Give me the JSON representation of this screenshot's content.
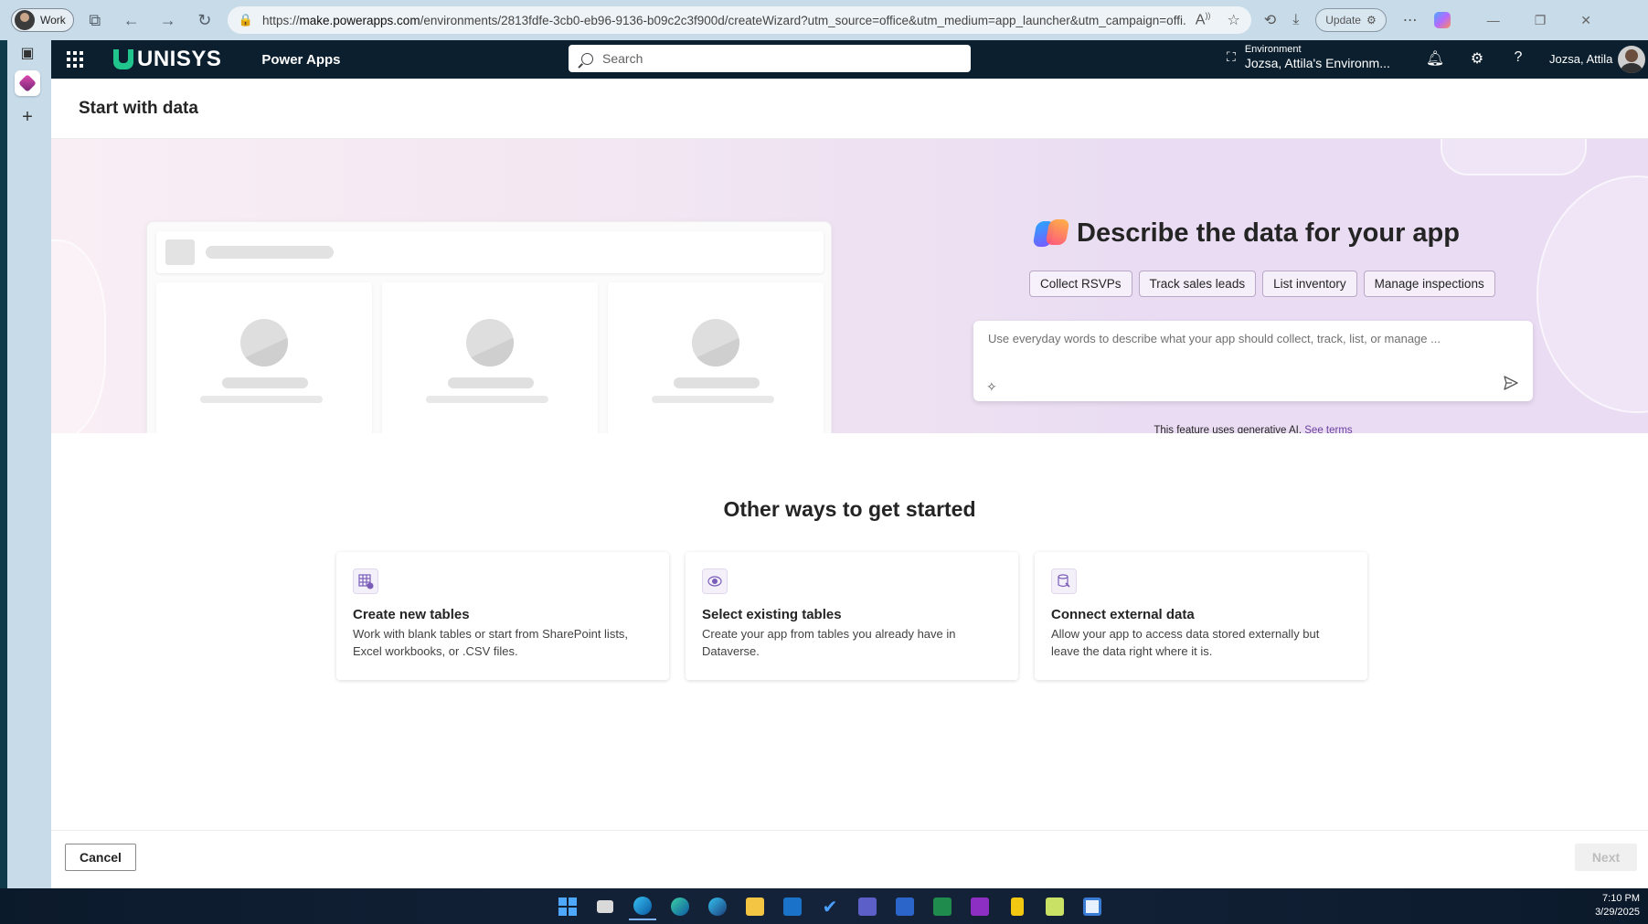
{
  "browser": {
    "profile_label": "Work",
    "url_prefix": "https://",
    "url_host": "make.powerapps.com",
    "url_path": "/environments/2813fdfe-3cb0-eb96-9136-b09c2c3f900d/createWizard?utm_source=office&utm_medium=app_launcher&utm_campaign=offi...",
    "update_label": "Update"
  },
  "header": {
    "brand": "UNISYS",
    "product": "Power Apps",
    "search_placeholder": "Search",
    "environment_label": "Environment",
    "environment_name": "Jozsa, Attila's Environm...",
    "user_name": "Jozsa, Attila"
  },
  "page": {
    "title": "Start with data"
  },
  "hero": {
    "heading": "Describe the data for your app",
    "chips": [
      "Collect RSVPs",
      "Track sales leads",
      "List inventory",
      "Manage inspections"
    ],
    "prompt_placeholder": "Use everyday words to describe what your app should collect, track, list, or manage ...",
    "ai_note": "This feature uses generative AI.",
    "see_terms": "See terms"
  },
  "other_ways": {
    "title": "Other ways to get started",
    "cards": [
      {
        "title": "Create new tables",
        "desc": "Work with blank tables or start from SharePoint lists, Excel workbooks, or .CSV files.",
        "icon": "table-add-icon"
      },
      {
        "title": "Select existing tables",
        "desc": "Create your app from tables you already have in Dataverse.",
        "icon": "dataverse-icon"
      },
      {
        "title": "Connect external data",
        "desc": "Allow your app to access data stored externally but leave the data right where it is.",
        "icon": "database-link-icon"
      }
    ]
  },
  "footer": {
    "cancel_label": "Cancel",
    "next_label": "Next"
  },
  "taskbar": {
    "time": "7:10 PM",
    "date": "3/29/2025"
  },
  "colors": {
    "header_bg": "#0b1f2e",
    "brand_accent": "#20c58e",
    "link_purple": "#6b3fa0"
  }
}
